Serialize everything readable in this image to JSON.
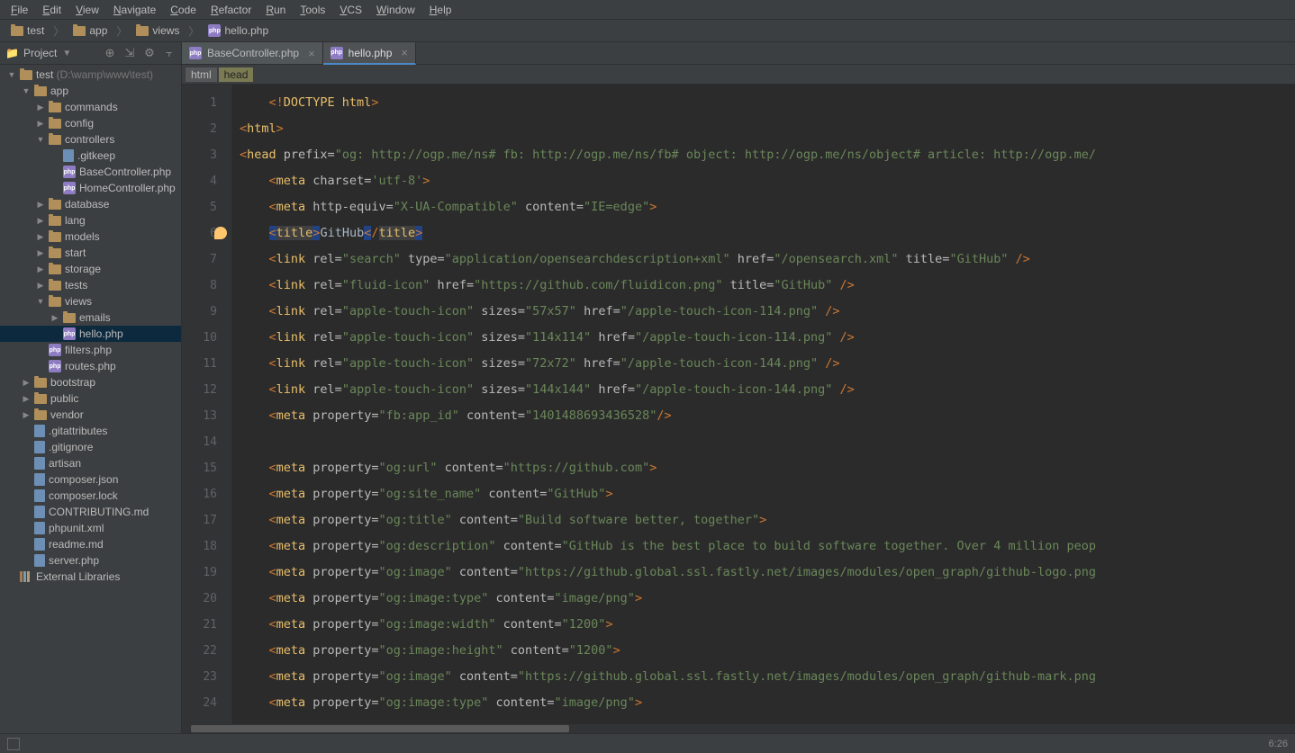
{
  "menu": [
    "File",
    "Edit",
    "View",
    "Navigate",
    "Code",
    "Refactor",
    "Run",
    "Tools",
    "VCS",
    "Window",
    "Help"
  ],
  "breadcrumbs": [
    {
      "icon": "folder",
      "label": "test"
    },
    {
      "icon": "folder",
      "label": "app"
    },
    {
      "icon": "folder",
      "label": "views"
    },
    {
      "icon": "php",
      "label": "hello.php"
    }
  ],
  "sidebar": {
    "title": "Project",
    "tree": [
      {
        "d": 0,
        "arrow": "expanded",
        "icon": "folder",
        "label": "test",
        "suffix": " (D:\\wamp\\www\\test)"
      },
      {
        "d": 1,
        "arrow": "expanded",
        "icon": "folder",
        "label": "app"
      },
      {
        "d": 2,
        "arrow": "collapsed",
        "icon": "folder",
        "label": "commands"
      },
      {
        "d": 2,
        "arrow": "collapsed",
        "icon": "folder",
        "label": "config"
      },
      {
        "d": 2,
        "arrow": "expanded",
        "icon": "folder",
        "label": "controllers"
      },
      {
        "d": 3,
        "arrow": "",
        "icon": "file",
        "label": ".gitkeep"
      },
      {
        "d": 3,
        "arrow": "",
        "icon": "php",
        "label": "BaseController.php"
      },
      {
        "d": 3,
        "arrow": "",
        "icon": "php",
        "label": "HomeController.php"
      },
      {
        "d": 2,
        "arrow": "collapsed",
        "icon": "folder",
        "label": "database"
      },
      {
        "d": 2,
        "arrow": "collapsed",
        "icon": "folder",
        "label": "lang"
      },
      {
        "d": 2,
        "arrow": "collapsed",
        "icon": "folder",
        "label": "models"
      },
      {
        "d": 2,
        "arrow": "collapsed",
        "icon": "folder",
        "label": "start"
      },
      {
        "d": 2,
        "arrow": "collapsed",
        "icon": "folder",
        "label": "storage"
      },
      {
        "d": 2,
        "arrow": "collapsed",
        "icon": "folder",
        "label": "tests"
      },
      {
        "d": 2,
        "arrow": "expanded",
        "icon": "folder",
        "label": "views"
      },
      {
        "d": 3,
        "arrow": "collapsed",
        "icon": "folder",
        "label": "emails"
      },
      {
        "d": 3,
        "arrow": "",
        "icon": "php",
        "label": "hello.php",
        "selected": true
      },
      {
        "d": 2,
        "arrow": "",
        "icon": "php",
        "label": "filters.php"
      },
      {
        "d": 2,
        "arrow": "",
        "icon": "php",
        "label": "routes.php"
      },
      {
        "d": 1,
        "arrow": "collapsed",
        "icon": "folder",
        "label": "bootstrap"
      },
      {
        "d": 1,
        "arrow": "collapsed",
        "icon": "folder",
        "label": "public"
      },
      {
        "d": 1,
        "arrow": "collapsed",
        "icon": "folder",
        "label": "vendor"
      },
      {
        "d": 1,
        "arrow": "",
        "icon": "file",
        "label": ".gitattributes"
      },
      {
        "d": 1,
        "arrow": "",
        "icon": "file",
        "label": ".gitignore"
      },
      {
        "d": 1,
        "arrow": "",
        "icon": "file",
        "label": "artisan"
      },
      {
        "d": 1,
        "arrow": "",
        "icon": "file",
        "label": "composer.json"
      },
      {
        "d": 1,
        "arrow": "",
        "icon": "file",
        "label": "composer.lock"
      },
      {
        "d": 1,
        "arrow": "",
        "icon": "file",
        "label": "CONTRIBUTING.md"
      },
      {
        "d": 1,
        "arrow": "",
        "icon": "file",
        "label": "phpunit.xml"
      },
      {
        "d": 1,
        "arrow": "",
        "icon": "file",
        "label": "readme.md"
      },
      {
        "d": 1,
        "arrow": "",
        "icon": "file",
        "label": "server.php"
      },
      {
        "d": 0,
        "arrow": "",
        "icon": "lib",
        "label": "External Libraries"
      }
    ]
  },
  "tabs": [
    {
      "icon": "php",
      "label": "BaseController.php",
      "active": false
    },
    {
      "icon": "php",
      "label": "hello.php",
      "active": true
    }
  ],
  "crumbs": [
    "html",
    "head"
  ],
  "code_lines": [
    {
      "n": 1,
      "tokens": [
        [
          "    ",
          "t-text"
        ],
        [
          "<!",
          "t-punct"
        ],
        [
          "DOCTYPE html",
          "t-tag"
        ],
        [
          ">",
          "t-punct"
        ]
      ]
    },
    {
      "n": 2,
      "tokens": [
        [
          "<",
          "t-punct"
        ],
        [
          "html",
          "t-tag"
        ],
        [
          ">",
          "t-punct"
        ]
      ]
    },
    {
      "n": 3,
      "tokens": [
        [
          "<",
          "t-punct"
        ],
        [
          "head ",
          "t-tag"
        ],
        [
          "prefix=",
          "t-attr"
        ],
        [
          "\"og: http://ogp.me/ns# fb: http://ogp.me/ns/fb# object: http://ogp.me/ns/object# article: http://ogp.me/",
          "t-str"
        ]
      ]
    },
    {
      "n": 4,
      "tokens": [
        [
          "    ",
          "t-text"
        ],
        [
          "<",
          "t-punct"
        ],
        [
          "meta ",
          "t-tag"
        ],
        [
          "charset=",
          "t-attr"
        ],
        [
          "'utf-8'",
          "t-str"
        ],
        [
          ">",
          "t-punct"
        ]
      ]
    },
    {
      "n": 5,
      "tokens": [
        [
          "    ",
          "t-text"
        ],
        [
          "<",
          "t-punct"
        ],
        [
          "meta ",
          "t-tag"
        ],
        [
          "http-equiv=",
          "t-attr"
        ],
        [
          "\"X-UA-Compatible\" ",
          "t-str"
        ],
        [
          "content=",
          "t-attr"
        ],
        [
          "\"IE=edge\"",
          "t-str"
        ],
        [
          ">",
          "t-punct"
        ]
      ]
    },
    {
      "n": 6,
      "tokens": [
        [
          "    ",
          "t-text"
        ],
        [
          "<",
          "t-punct sel"
        ],
        [
          "title",
          "t-tag hl-title"
        ],
        [
          ">",
          "t-punct sel"
        ],
        [
          "GitHub",
          "t-text"
        ],
        [
          "<",
          "t-punct sel"
        ],
        [
          "/",
          "t-punct"
        ],
        [
          "title",
          "t-tag hl-title"
        ],
        [
          ">",
          "t-punct sel"
        ]
      ]
    },
    {
      "n": 7,
      "tokens": [
        [
          "    ",
          "t-text"
        ],
        [
          "<",
          "t-punct"
        ],
        [
          "link ",
          "t-tag"
        ],
        [
          "rel=",
          "t-attr"
        ],
        [
          "\"search\" ",
          "t-str"
        ],
        [
          "type=",
          "t-attr"
        ],
        [
          "\"application/opensearchdescription+xml\" ",
          "t-str"
        ],
        [
          "href=",
          "t-attr"
        ],
        [
          "\"/opensearch.xml\" ",
          "t-str"
        ],
        [
          "title=",
          "t-attr"
        ],
        [
          "\"GitHub\" ",
          "t-str"
        ],
        [
          "/>",
          "t-punct"
        ]
      ]
    },
    {
      "n": 8,
      "tokens": [
        [
          "    ",
          "t-text"
        ],
        [
          "<",
          "t-punct"
        ],
        [
          "link ",
          "t-tag"
        ],
        [
          "rel=",
          "t-attr"
        ],
        [
          "\"fluid-icon\" ",
          "t-str"
        ],
        [
          "href=",
          "t-attr"
        ],
        [
          "\"https://github.com/fluidicon.png\" ",
          "t-str"
        ],
        [
          "title=",
          "t-attr"
        ],
        [
          "\"GitHub\" ",
          "t-str"
        ],
        [
          "/>",
          "t-punct"
        ]
      ]
    },
    {
      "n": 9,
      "tokens": [
        [
          "    ",
          "t-text"
        ],
        [
          "<",
          "t-punct"
        ],
        [
          "link ",
          "t-tag"
        ],
        [
          "rel=",
          "t-attr"
        ],
        [
          "\"apple-touch-icon\" ",
          "t-str"
        ],
        [
          "sizes=",
          "t-attr"
        ],
        [
          "\"57x57\" ",
          "t-str"
        ],
        [
          "href=",
          "t-attr"
        ],
        [
          "\"/apple-touch-icon-114.png\" ",
          "t-str"
        ],
        [
          "/>",
          "t-punct"
        ]
      ]
    },
    {
      "n": 10,
      "tokens": [
        [
          "    ",
          "t-text"
        ],
        [
          "<",
          "t-punct"
        ],
        [
          "link ",
          "t-tag"
        ],
        [
          "rel=",
          "t-attr"
        ],
        [
          "\"apple-touch-icon\" ",
          "t-str"
        ],
        [
          "sizes=",
          "t-attr"
        ],
        [
          "\"114x114\" ",
          "t-str"
        ],
        [
          "href=",
          "t-attr"
        ],
        [
          "\"/apple-touch-icon-114.png\" ",
          "t-str"
        ],
        [
          "/>",
          "t-punct"
        ]
      ]
    },
    {
      "n": 11,
      "tokens": [
        [
          "    ",
          "t-text"
        ],
        [
          "<",
          "t-punct"
        ],
        [
          "link ",
          "t-tag"
        ],
        [
          "rel=",
          "t-attr"
        ],
        [
          "\"apple-touch-icon\" ",
          "t-str"
        ],
        [
          "sizes=",
          "t-attr"
        ],
        [
          "\"72x72\" ",
          "t-str"
        ],
        [
          "href=",
          "t-attr"
        ],
        [
          "\"/apple-touch-icon-144.png\" ",
          "t-str"
        ],
        [
          "/>",
          "t-punct"
        ]
      ]
    },
    {
      "n": 12,
      "tokens": [
        [
          "    ",
          "t-text"
        ],
        [
          "<",
          "t-punct"
        ],
        [
          "link ",
          "t-tag"
        ],
        [
          "rel=",
          "t-attr"
        ],
        [
          "\"apple-touch-icon\" ",
          "t-str"
        ],
        [
          "sizes=",
          "t-attr"
        ],
        [
          "\"144x144\" ",
          "t-str"
        ],
        [
          "href=",
          "t-attr"
        ],
        [
          "\"/apple-touch-icon-144.png\" ",
          "t-str"
        ],
        [
          "/>",
          "t-punct"
        ]
      ]
    },
    {
      "n": 13,
      "tokens": [
        [
          "    ",
          "t-text"
        ],
        [
          "<",
          "t-punct"
        ],
        [
          "meta ",
          "t-tag"
        ],
        [
          "property=",
          "t-attr"
        ],
        [
          "\"fb:app_id\" ",
          "t-str"
        ],
        [
          "content=",
          "t-attr"
        ],
        [
          "\"1401488693436528\"",
          "t-str"
        ],
        [
          "/>",
          "t-punct"
        ]
      ]
    },
    {
      "n": 14,
      "tokens": [
        [
          "",
          ""
        ]
      ]
    },
    {
      "n": 15,
      "tokens": [
        [
          "    ",
          "t-text"
        ],
        [
          "<",
          "t-punct"
        ],
        [
          "meta ",
          "t-tag"
        ],
        [
          "property=",
          "t-attr"
        ],
        [
          "\"og:url\" ",
          "t-str"
        ],
        [
          "content=",
          "t-attr"
        ],
        [
          "\"https://github.com\"",
          "t-str"
        ],
        [
          ">",
          "t-punct"
        ]
      ]
    },
    {
      "n": 16,
      "tokens": [
        [
          "    ",
          "t-text"
        ],
        [
          "<",
          "t-punct"
        ],
        [
          "meta ",
          "t-tag"
        ],
        [
          "property=",
          "t-attr"
        ],
        [
          "\"og:site_name\" ",
          "t-str"
        ],
        [
          "content=",
          "t-attr"
        ],
        [
          "\"GitHub\"",
          "t-str"
        ],
        [
          ">",
          "t-punct"
        ]
      ]
    },
    {
      "n": 17,
      "tokens": [
        [
          "    ",
          "t-text"
        ],
        [
          "<",
          "t-punct"
        ],
        [
          "meta ",
          "t-tag"
        ],
        [
          "property=",
          "t-attr"
        ],
        [
          "\"og:title\" ",
          "t-str"
        ],
        [
          "content=",
          "t-attr"
        ],
        [
          "\"Build software better, together\"",
          "t-str"
        ],
        [
          ">",
          "t-punct"
        ]
      ]
    },
    {
      "n": 18,
      "tokens": [
        [
          "    ",
          "t-text"
        ],
        [
          "<",
          "t-punct"
        ],
        [
          "meta ",
          "t-tag"
        ],
        [
          "property=",
          "t-attr"
        ],
        [
          "\"og:description\" ",
          "t-str"
        ],
        [
          "content=",
          "t-attr"
        ],
        [
          "\"GitHub is the best place to build software together. Over 4 million peop",
          "t-str"
        ]
      ]
    },
    {
      "n": 19,
      "tokens": [
        [
          "    ",
          "t-text"
        ],
        [
          "<",
          "t-punct"
        ],
        [
          "meta ",
          "t-tag"
        ],
        [
          "property=",
          "t-attr"
        ],
        [
          "\"og:image\" ",
          "t-str"
        ],
        [
          "content=",
          "t-attr"
        ],
        [
          "\"https://github.global.ssl.fastly.net/images/modules/open_graph/github-logo.png",
          "t-str"
        ]
      ]
    },
    {
      "n": 20,
      "tokens": [
        [
          "    ",
          "t-text"
        ],
        [
          "<",
          "t-punct"
        ],
        [
          "meta ",
          "t-tag"
        ],
        [
          "property=",
          "t-attr"
        ],
        [
          "\"og:image:type\" ",
          "t-str"
        ],
        [
          "content=",
          "t-attr"
        ],
        [
          "\"image/png\"",
          "t-str"
        ],
        [
          ">",
          "t-punct"
        ]
      ]
    },
    {
      "n": 21,
      "tokens": [
        [
          "    ",
          "t-text"
        ],
        [
          "<",
          "t-punct"
        ],
        [
          "meta ",
          "t-tag"
        ],
        [
          "property=",
          "t-attr"
        ],
        [
          "\"og:image:width\" ",
          "t-str"
        ],
        [
          "content=",
          "t-attr"
        ],
        [
          "\"1200\"",
          "t-str"
        ],
        [
          ">",
          "t-punct"
        ]
      ]
    },
    {
      "n": 22,
      "tokens": [
        [
          "    ",
          "t-text"
        ],
        [
          "<",
          "t-punct"
        ],
        [
          "meta ",
          "t-tag"
        ],
        [
          "property=",
          "t-attr"
        ],
        [
          "\"og:image:height\" ",
          "t-str"
        ],
        [
          "content=",
          "t-attr"
        ],
        [
          "\"1200\"",
          "t-str"
        ],
        [
          ">",
          "t-punct"
        ]
      ]
    },
    {
      "n": 23,
      "tokens": [
        [
          "    ",
          "t-text"
        ],
        [
          "<",
          "t-punct"
        ],
        [
          "meta ",
          "t-tag"
        ],
        [
          "property=",
          "t-attr"
        ],
        [
          "\"og:image\" ",
          "t-str"
        ],
        [
          "content=",
          "t-attr"
        ],
        [
          "\"https://github.global.ssl.fastly.net/images/modules/open_graph/github-mark.png",
          "t-str"
        ]
      ]
    },
    {
      "n": 24,
      "tokens": [
        [
          "    ",
          "t-text"
        ],
        [
          "<",
          "t-punct"
        ],
        [
          "meta ",
          "t-tag"
        ],
        [
          "property=",
          "t-attr"
        ],
        [
          "\"og:image:type\" ",
          "t-str"
        ],
        [
          "content=",
          "t-attr"
        ],
        [
          "\"image/png\"",
          "t-str"
        ],
        [
          ">",
          "t-punct"
        ]
      ]
    }
  ],
  "statusbar": {
    "position": "6:26"
  }
}
